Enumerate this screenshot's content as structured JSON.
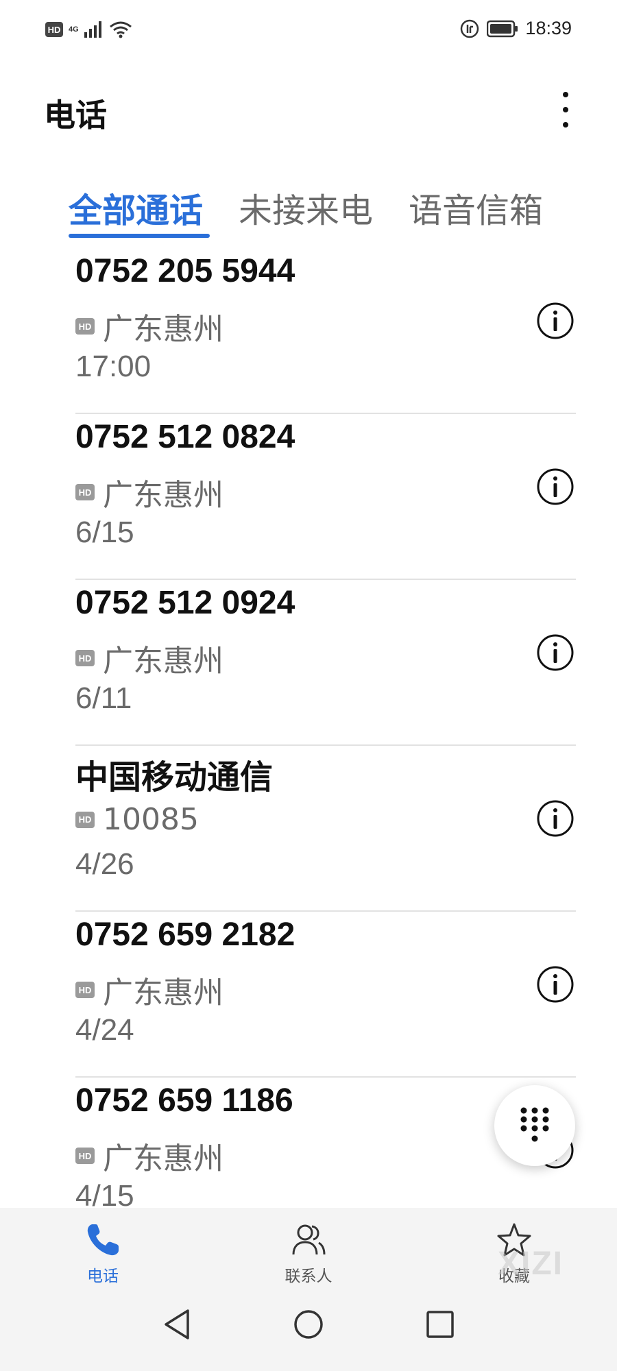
{
  "status_bar": {
    "hd_badge": "HD",
    "network": "4G",
    "time": "18:39",
    "icons": [
      "hd-icon",
      "signal-icon",
      "wifi-icon",
      "data-saver-icon",
      "battery-icon"
    ]
  },
  "header": {
    "title": "电话",
    "more_icon": "more-vertical-icon"
  },
  "tabs": [
    {
      "label": "全部通话",
      "active": true
    },
    {
      "label": "未接来电",
      "active": false
    },
    {
      "label": "语音信箱",
      "active": false
    }
  ],
  "calls": [
    {
      "name": "0752 205 5944",
      "hd": "HD",
      "location": "广东惠州",
      "time": "17:00"
    },
    {
      "name": "0752 512 0824",
      "hd": "HD",
      "location": "广东惠州",
      "time": "6/15"
    },
    {
      "name": "0752 512 0924",
      "hd": "HD",
      "location": "广东惠州",
      "time": "6/11"
    },
    {
      "name": "中国移动通信",
      "hd": "HD",
      "location": "10085",
      "time": "4/26"
    },
    {
      "name": "0752 659 2182",
      "hd": "HD",
      "location": "广东惠州",
      "time": "4/24"
    },
    {
      "name": "0752 659 1186",
      "hd": "HD",
      "location": "广东惠州",
      "time": "4/15"
    }
  ],
  "fab": {
    "icon": "dialpad-icon"
  },
  "bottom_nav": [
    {
      "label": "电话",
      "icon": "phone-icon",
      "active": true
    },
    {
      "label": "联系人",
      "icon": "contacts-icon",
      "active": false
    },
    {
      "label": "收藏",
      "icon": "star-icon",
      "active": false
    }
  ],
  "system_nav": [
    "back-icon",
    "home-icon",
    "recents-icon"
  ],
  "watermark": "XIZI",
  "colors": {
    "accent": "#2a6fd9",
    "text_primary": "#111111",
    "text_secondary": "#6a6a6a",
    "divider": "#e2e2e2",
    "nav_background": "#f4f4f4"
  }
}
